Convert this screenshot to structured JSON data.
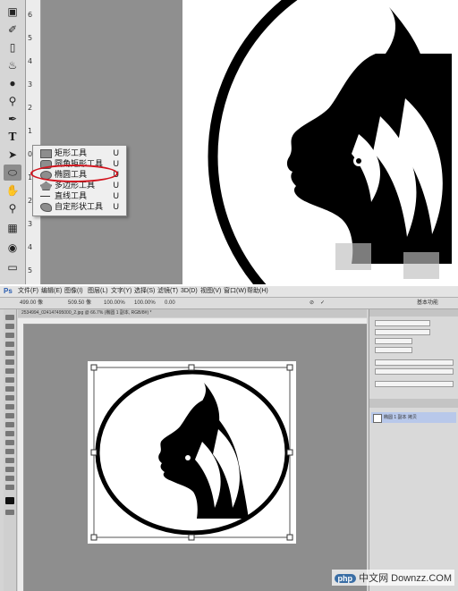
{
  "top_panel": {
    "ruler_numbers": [
      "6",
      "5",
      "4",
      "3",
      "2",
      "1",
      "0",
      "1",
      "2",
      "3",
      "4",
      "5"
    ],
    "flyout_menu": {
      "items": [
        {
          "label": "矩形工具",
          "shortcut": "U"
        },
        {
          "label": "圆角矩形工具",
          "shortcut": "U"
        },
        {
          "label": "椭圆工具",
          "shortcut": "U"
        },
        {
          "label": "多边形工具",
          "shortcut": "U"
        },
        {
          "label": "直线工具",
          "shortcut": "U"
        },
        {
          "label": "自定形状工具",
          "shortcut": "U"
        }
      ],
      "highlighted_item": "椭圆工具",
      "highlight_color": "#d2141e"
    }
  },
  "bottom_panel": {
    "app_logo": "Ps",
    "menu": [
      "文件(F)",
      "编辑(E)",
      "图像(I)",
      "图层(L)",
      "文字(Y)",
      "选择(S)",
      "滤镜(T)",
      "3D(D)",
      "视图(V)",
      "窗口(W)",
      "帮助(H)"
    ],
    "options": {
      "x_value": "499.00 像",
      "y_value": "509.50 像",
      "w_value": "100.00%",
      "h_value": "100.00%",
      "angle_value": "0.00",
      "workspace": "基本功能"
    },
    "doc_tab": "2534994_024147495000_2.jpg @ 66.7% (椭圆 1 副本, RGB/8#) *",
    "layer_name": "椭圆 1 副本 拷贝"
  },
  "watermark": {
    "brand": "php",
    "text": "中文网",
    "site": "Downzz.COM"
  },
  "colors": {
    "toolbar_bg": "#d6d6d6",
    "canvas_gray": "#8f8f8f",
    "highlight_red": "#d2141e",
    "layer_selected": "#b8c8ea"
  }
}
